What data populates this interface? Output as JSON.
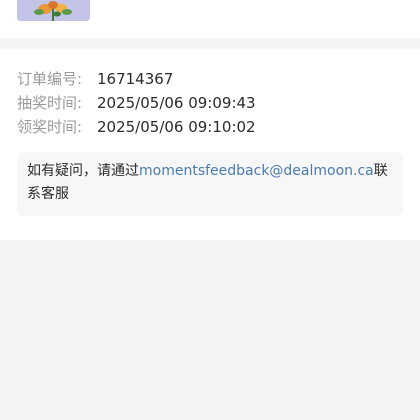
{
  "prize": {
    "image_icon": "flower-bouquet-thumbnail"
  },
  "order": {
    "order_no_label": "订单编号:",
    "order_no": "16714367",
    "draw_time_label": "抽奖时间:",
    "draw_time": "2025/05/06 09:09:43",
    "claim_time_label": "领奖时间:",
    "claim_time": "2025/05/06 09:10:02"
  },
  "notice": {
    "prefix": "如有疑问，请通过",
    "email": "momentsfeedback@dealmoon.ca",
    "suffix": "联系客服"
  },
  "colors": {
    "background": "#f4f4f4",
    "card": "#ffffff",
    "label": "#9a9a9a",
    "text": "#2b2b2b",
    "link": "#4a7bb0",
    "thumb": "#c4c4e8"
  }
}
